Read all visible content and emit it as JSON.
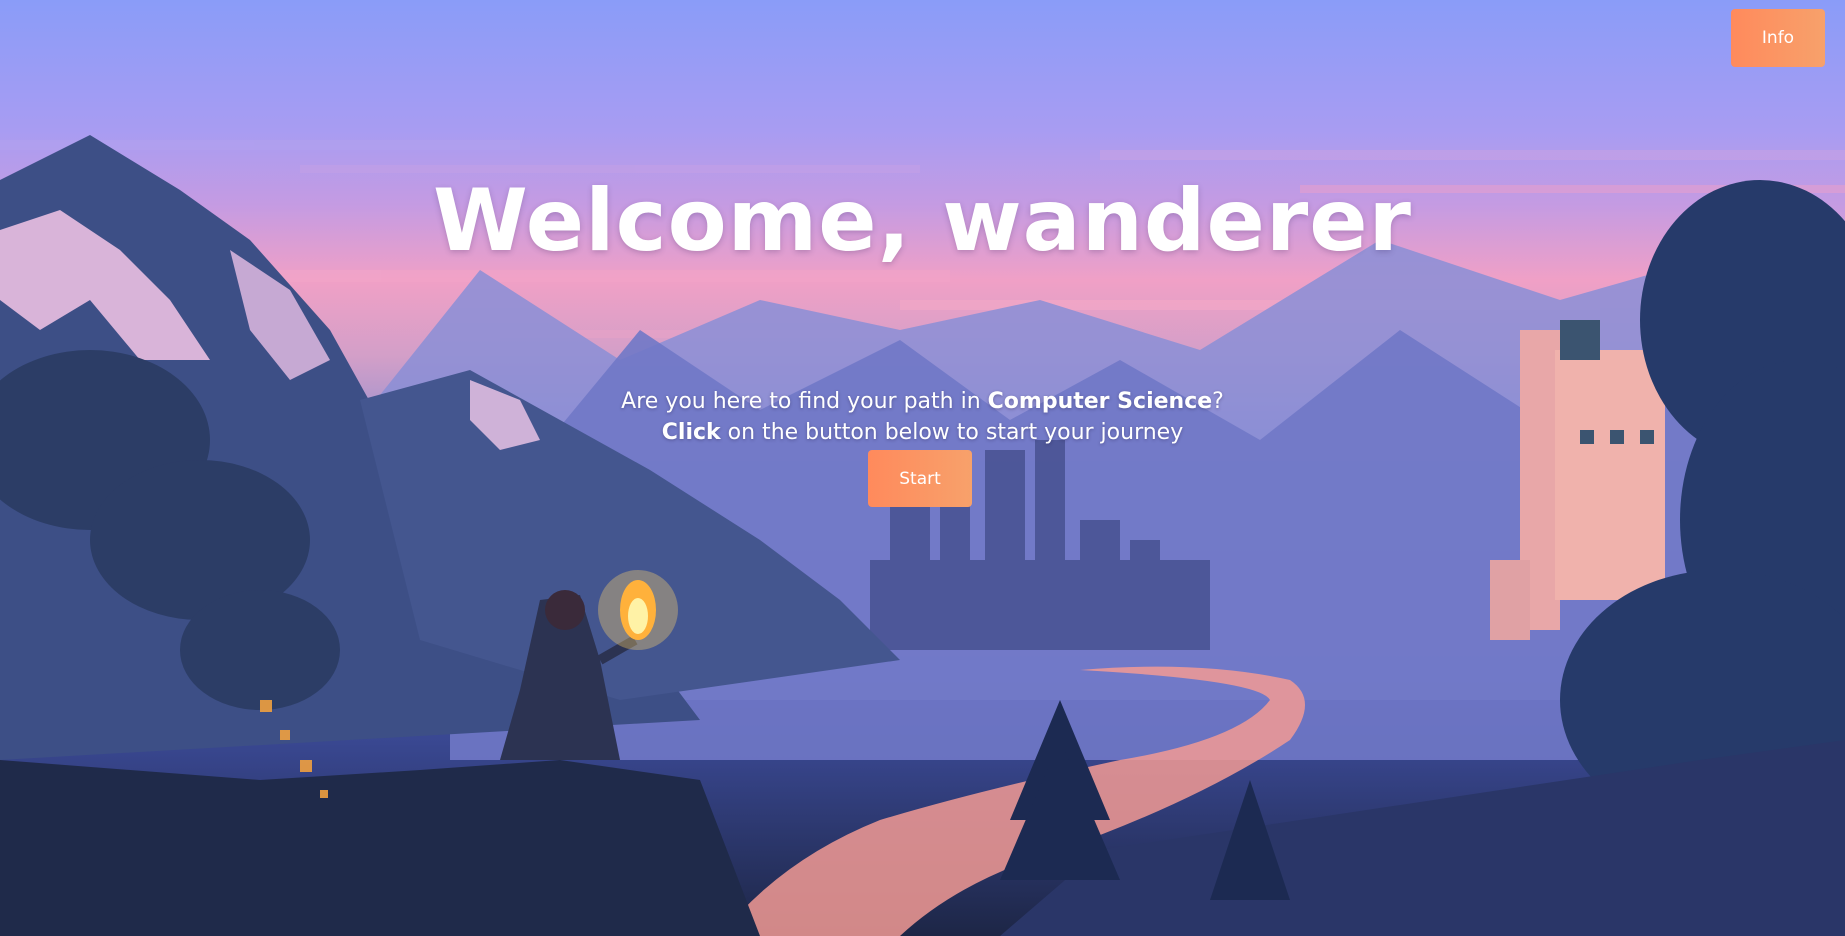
{
  "header": {
    "info_label": "Info"
  },
  "hero": {
    "title": "Welcome, wanderer",
    "line1_prefix": "Are you here to find your path in ",
    "line1_bold": "Computer Science",
    "line1_suffix": "?",
    "line2_bold": "Click",
    "line2_rest": " on the button below to start your journey",
    "start_label": "Start"
  },
  "colors": {
    "button_start": "#ff8a5c",
    "button_end": "#f7a16b",
    "sky_top": "#8a9cf8",
    "sky_pink": "#f0a0c6",
    "ground": "#1d2646"
  },
  "background": {
    "icon": "pixel-art-mountain-landscape",
    "elements": [
      "mountains",
      "castle-silhouette",
      "pink-tower",
      "glowing-river",
      "wanderer-with-torch",
      "pine-trees"
    ]
  }
}
